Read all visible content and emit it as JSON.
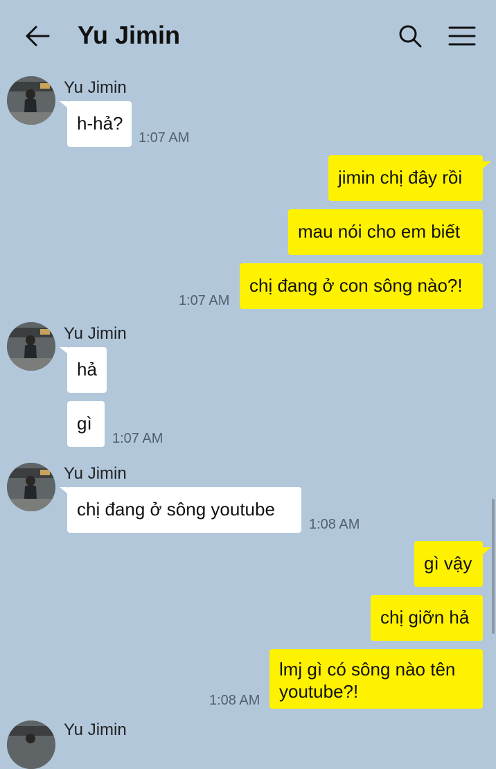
{
  "header": {
    "title": "Yu Jimin",
    "back_icon": "arrow-left-icon",
    "search_icon": "search-icon",
    "menu_icon": "hamburger-menu-icon"
  },
  "colors": {
    "background": "#b2c7da",
    "outgoing_bubble": "#fff200",
    "incoming_bubble": "#ffffff"
  },
  "messages": {
    "g1": {
      "sender": "Yu Jimin",
      "m1": "h-hả?",
      "time": "1:07 AM"
    },
    "g2": {
      "m1": "jimin chị đây rồi",
      "m2": "mau nói cho em biết",
      "m3": "chị đang ở con sông nào?!",
      "time": "1:07 AM"
    },
    "g3": {
      "sender": "Yu Jimin",
      "m1": "hả",
      "m2": "gì",
      "time": "1:07 AM"
    },
    "g4": {
      "sender": "Yu Jimin",
      "m1": "chị đang ở sông youtube",
      "time": "1:08 AM"
    },
    "g5": {
      "m1": "gì vậy",
      "m2": "chị giỡn hả",
      "m3": "lmj gì có sông nào tên youtube?!",
      "time": "1:08 AM"
    },
    "g6": {
      "sender": "Yu Jimin"
    }
  }
}
